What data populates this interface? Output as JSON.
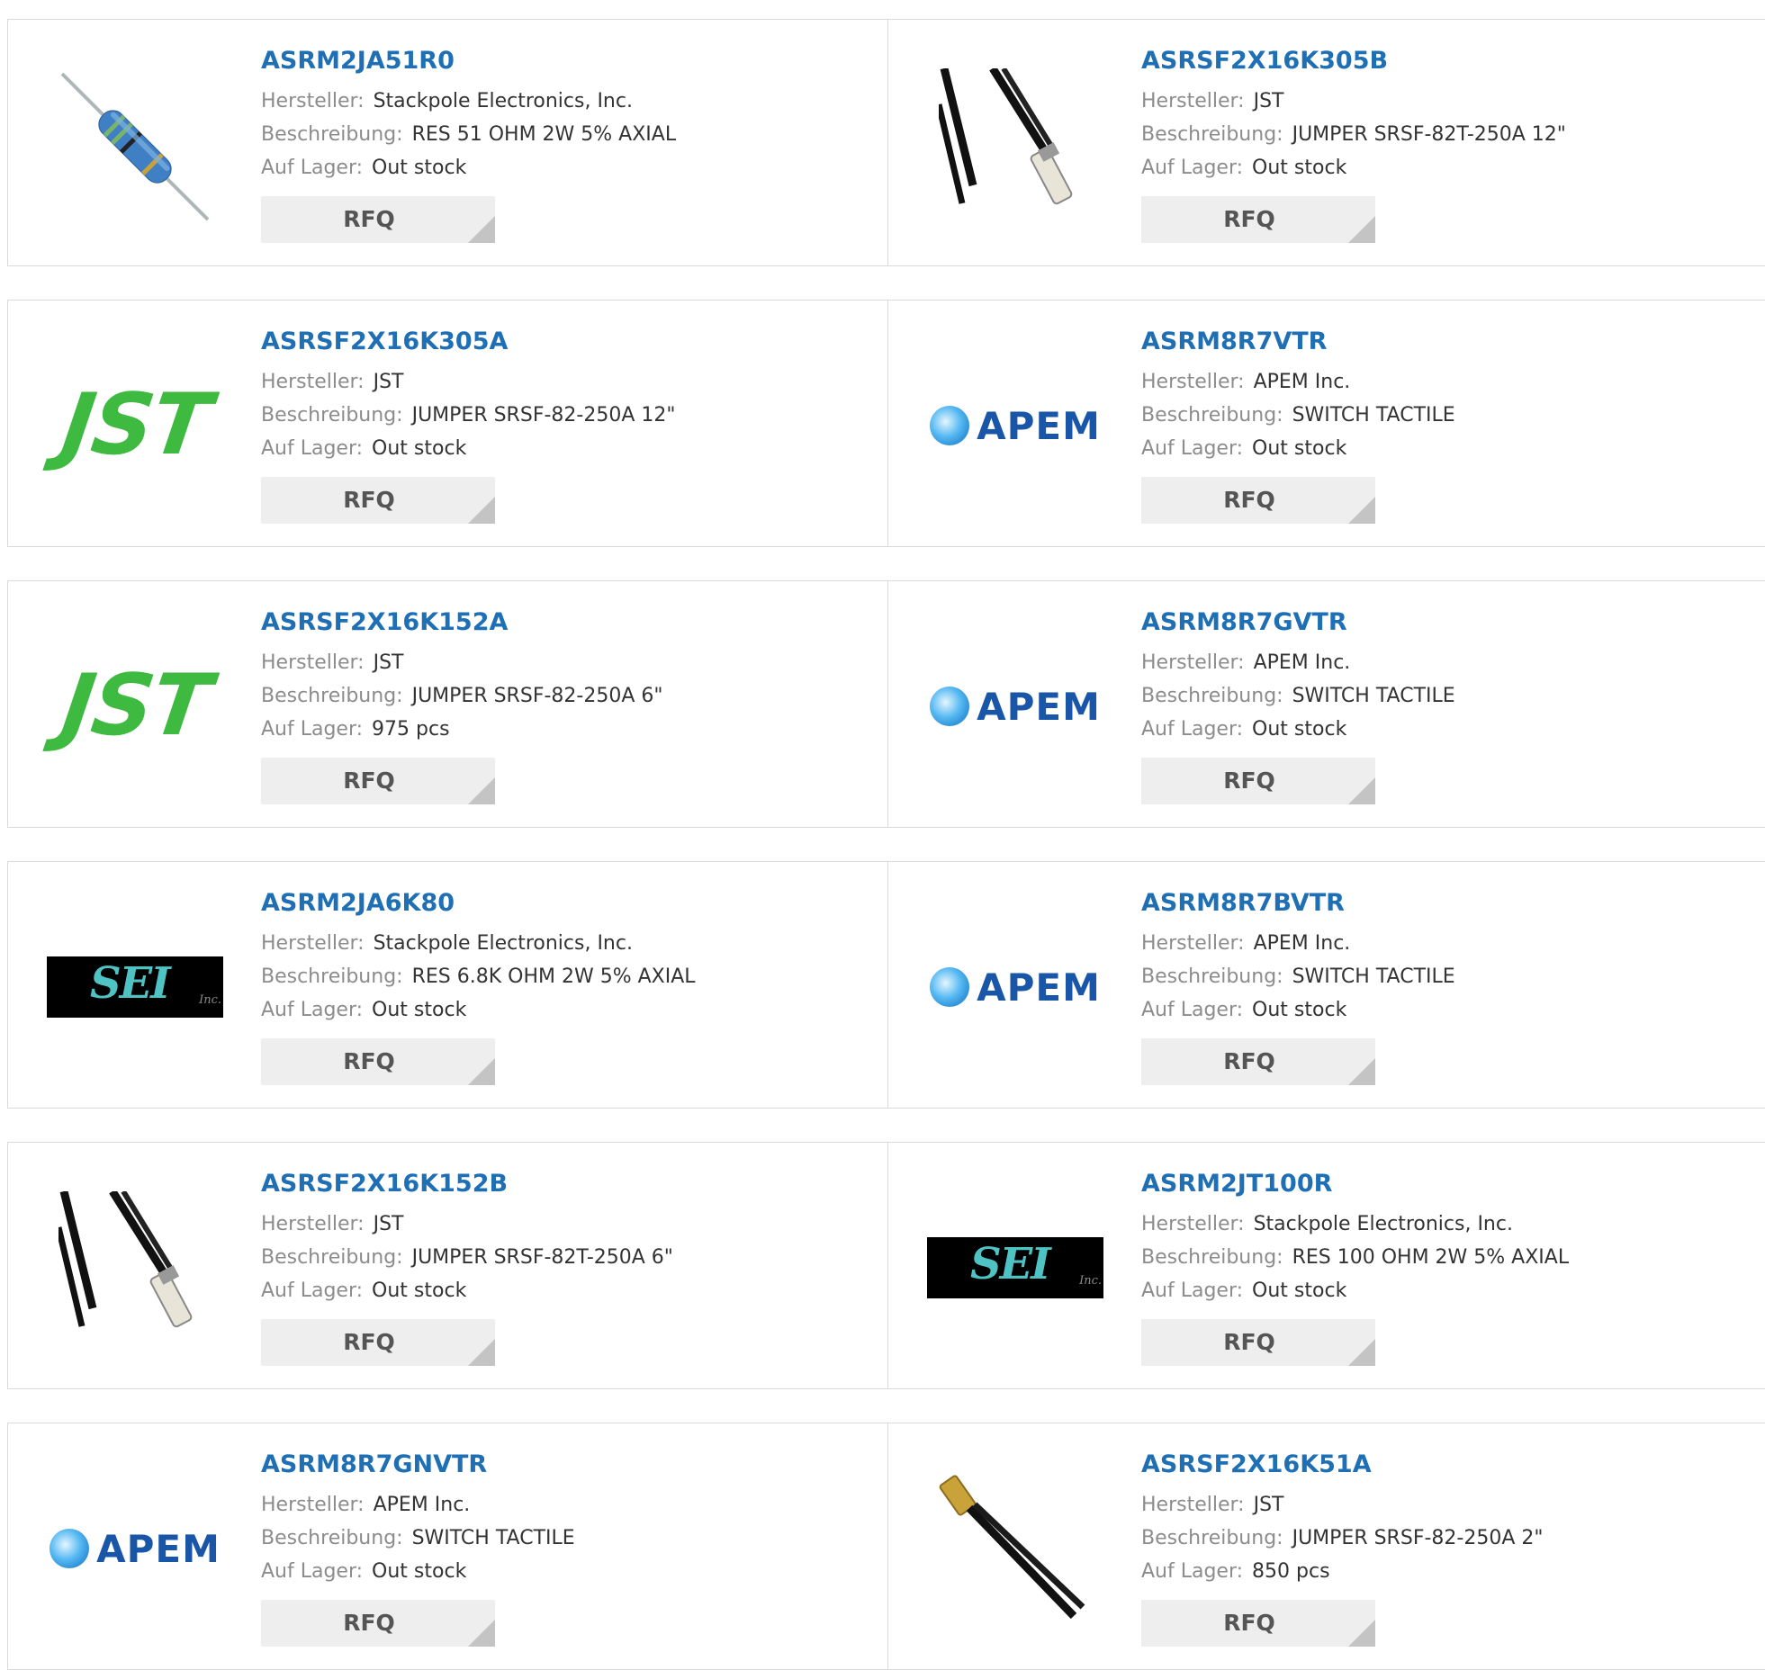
{
  "labels": {
    "manufacturer": "Hersteller:",
    "description": "Beschreibung:",
    "stock": "Auf Lager:",
    "rfq": "RFQ"
  },
  "logos": {
    "jst": "JST",
    "apem": "APEM",
    "sei": "SEI",
    "sei_inc": "Inc."
  },
  "products": [
    {
      "part": "ASRM2JA51R0",
      "manufacturer": "Stackpole Electronics, Inc.",
      "description": "RES 51 OHM 2W 5% AXIAL",
      "stock": "Out stock",
      "image": "resistor-photo"
    },
    {
      "part": "ASRSF2X16K305B",
      "manufacturer": "JST",
      "description": "JUMPER SRSF-82T-250A 12\"",
      "stock": "Out stock",
      "image": "jumper-wire-photo"
    },
    {
      "part": "ASRSF2X16K305A",
      "manufacturer": "JST",
      "description": "JUMPER SRSF-82-250A 12\"",
      "stock": "Out stock",
      "image": "jst-logo"
    },
    {
      "part": "ASRM8R7VTR",
      "manufacturer": "APEM Inc.",
      "description": "SWITCH TACTILE",
      "stock": "Out stock",
      "image": "apem-logo"
    },
    {
      "part": "ASRSF2X16K152A",
      "manufacturer": "JST",
      "description": "JUMPER SRSF-82-250A 6\"",
      "stock": "975 pcs",
      "image": "jst-logo"
    },
    {
      "part": "ASRM8R7GVTR",
      "manufacturer": "APEM Inc.",
      "description": "SWITCH TACTILE",
      "stock": "Out stock",
      "image": "apem-logo"
    },
    {
      "part": "ASRM2JA6K80",
      "manufacturer": "Stackpole Electronics, Inc.",
      "description": "RES 6.8K OHM 2W 5% AXIAL",
      "stock": "Out stock",
      "image": "sei-logo"
    },
    {
      "part": "ASRM8R7BVTR",
      "manufacturer": "APEM Inc.",
      "description": "SWITCH TACTILE",
      "stock": "Out stock",
      "image": "apem-logo"
    },
    {
      "part": "ASRSF2X16K152B",
      "manufacturer": "JST",
      "description": "JUMPER SRSF-82T-250A 6\"",
      "stock": "Out stock",
      "image": "jumper-wire-photo"
    },
    {
      "part": "ASRM2JT100R",
      "manufacturer": "Stackpole Electronics, Inc.",
      "description": "RES 100 OHM 2W 5% AXIAL",
      "stock": "Out stock",
      "image": "sei-logo"
    },
    {
      "part": "ASRM8R7GNVTR",
      "manufacturer": "APEM Inc.",
      "description": "SWITCH TACTILE",
      "stock": "Out stock",
      "image": "apem-logo"
    },
    {
      "part": "ASRSF2X16K51A",
      "manufacturer": "JST",
      "description": "JUMPER SRSF-82-250A 2\"",
      "stock": "850 pcs",
      "image": "single-jumper-photo"
    }
  ]
}
